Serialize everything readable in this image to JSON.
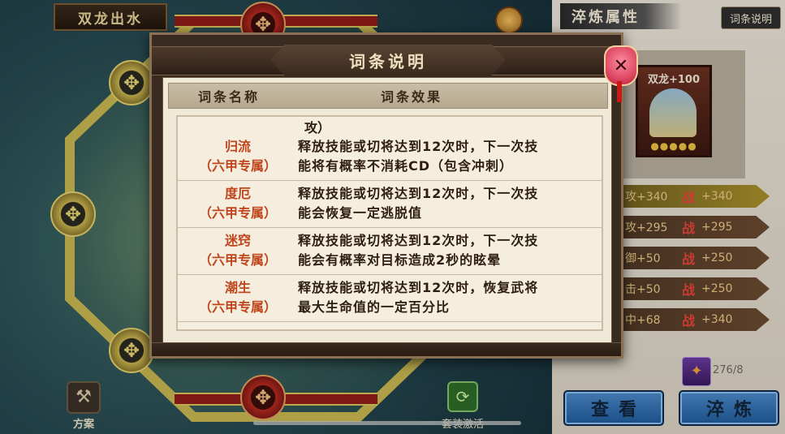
{
  "scene": {
    "title": "双龙出水",
    "scheme_label": "方案",
    "set_effect_label": "套装激活"
  },
  "right_panel": {
    "header": "淬炼属性",
    "explain_button": "词条说明",
    "item_name": "双龙+100",
    "stats": [
      {
        "left": "攻+340",
        "right": "+340"
      },
      {
        "left": "攻+295",
        "right": "+295"
      },
      {
        "left": "御+50",
        "right": "+250"
      },
      {
        "left": "击+50",
        "right": "+250"
      },
      {
        "left": "中+68",
        "right": "+340"
      }
    ],
    "battle_glyph": "战",
    "material_count": "276/8",
    "view_button": "查看",
    "refine_button": "淬炼"
  },
  "modal": {
    "title": "词条说明",
    "columns": {
      "name": "词条名称",
      "effect": "词条效果"
    },
    "partial_text": "攻）",
    "rows": [
      {
        "name": "归流",
        "tag": "（六甲专属）",
        "effect_l1": "释放技能或切将达到12次时，下一次技",
        "effect_l2": "能将有概率不消耗CD（包含冲刺）"
      },
      {
        "name": "度厄",
        "tag": "（六甲专属）",
        "effect_l1": "释放技能或切将达到12次时，下一次技",
        "effect_l2": "能会恢复一定逃脱值"
      },
      {
        "name": "迷窍",
        "tag": "（六甲专属）",
        "effect_l1": "释放技能或切将达到12次时，下一次技",
        "effect_l2": "能会有概率对目标造成2秒的眩晕"
      },
      {
        "name": "潮生",
        "tag": "（六甲专属）",
        "effect_l1": "释放技能或切将达到12次时，恢复武将",
        "effect_l2": "最大生命值的一定百分比"
      }
    ]
  }
}
